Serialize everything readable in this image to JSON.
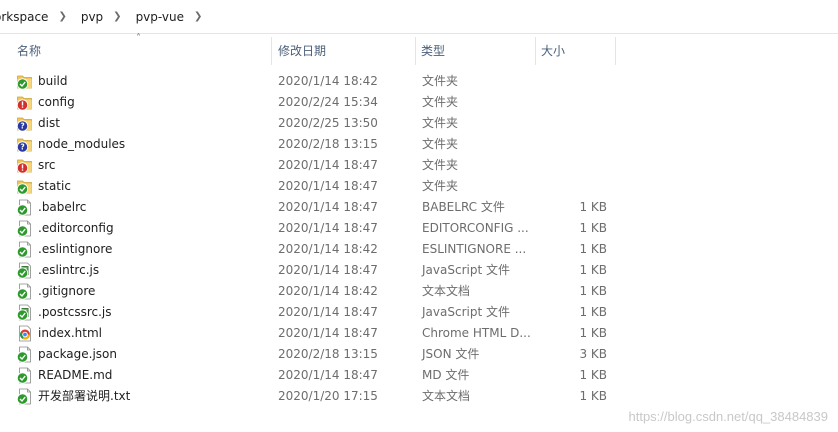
{
  "breadcrumb": [
    "orkspace",
    "pvp",
    "pvp-vue"
  ],
  "columns": {
    "name": "名称",
    "date": "修改日期",
    "type": "类型",
    "size": "大小"
  },
  "files": [
    {
      "name": "build",
      "date": "2020/1/14 18:42",
      "type": "文件夹",
      "size": "",
      "icon": "folder-ok-icon"
    },
    {
      "name": "config",
      "date": "2020/2/24 15:34",
      "type": "文件夹",
      "size": "",
      "icon": "folder-modified-icon"
    },
    {
      "name": "dist",
      "date": "2020/2/25 13:50",
      "type": "文件夹",
      "size": "",
      "icon": "folder-unversioned-icon"
    },
    {
      "name": "node_modules",
      "date": "2020/2/18 13:15",
      "type": "文件夹",
      "size": "",
      "icon": "folder-unversioned-icon"
    },
    {
      "name": "src",
      "date": "2020/1/14 18:47",
      "type": "文件夹",
      "size": "",
      "icon": "folder-modified-icon"
    },
    {
      "name": "static",
      "date": "2020/1/14 18:47",
      "type": "文件夹",
      "size": "",
      "icon": "folder-ok-icon"
    },
    {
      "name": ".babelrc",
      "date": "2020/1/14 18:47",
      "type": "BABELRC 文件",
      "size": "1 KB",
      "icon": "file-ok-icon"
    },
    {
      "name": ".editorconfig",
      "date": "2020/1/14 18:47",
      "type": "EDITORCONFIG ...",
      "size": "1 KB",
      "icon": "file-ok-icon"
    },
    {
      "name": ".eslintignore",
      "date": "2020/1/14 18:42",
      "type": "ESLINTIGNORE ...",
      "size": "1 KB",
      "icon": "file-ok-icon"
    },
    {
      "name": ".eslintrc.js",
      "date": "2020/1/14 18:47",
      "type": "JavaScript 文件",
      "size": "1 KB",
      "icon": "js-file-ok-icon"
    },
    {
      "name": ".gitignore",
      "date": "2020/1/14 18:42",
      "type": "文本文档",
      "size": "1 KB",
      "icon": "file-ok-icon"
    },
    {
      "name": ".postcssrc.js",
      "date": "2020/1/14 18:47",
      "type": "JavaScript 文件",
      "size": "1 KB",
      "icon": "js-file-ok-icon"
    },
    {
      "name": "index.html",
      "date": "2020/1/14 18:47",
      "type": "Chrome HTML D...",
      "size": "1 KB",
      "icon": "chrome-html-icon"
    },
    {
      "name": "package.json",
      "date": "2020/2/18 13:15",
      "type": "JSON 文件",
      "size": "3 KB",
      "icon": "file-ok-icon"
    },
    {
      "name": "README.md",
      "date": "2020/1/14 18:47",
      "type": "MD 文件",
      "size": "1 KB",
      "icon": "file-ok-icon"
    },
    {
      "name": "开发部署说明.txt",
      "date": "2020/1/20 17:15",
      "type": "文本文档",
      "size": "1 KB",
      "icon": "file-ok-icon"
    }
  ],
  "watermark": "https://blog.csdn.net/qq_38484839",
  "colors": {
    "ok": "#2e9a2e",
    "modified": "#d32f2f",
    "unversioned": "#2a3aa0",
    "folder": "#f2c75c"
  }
}
